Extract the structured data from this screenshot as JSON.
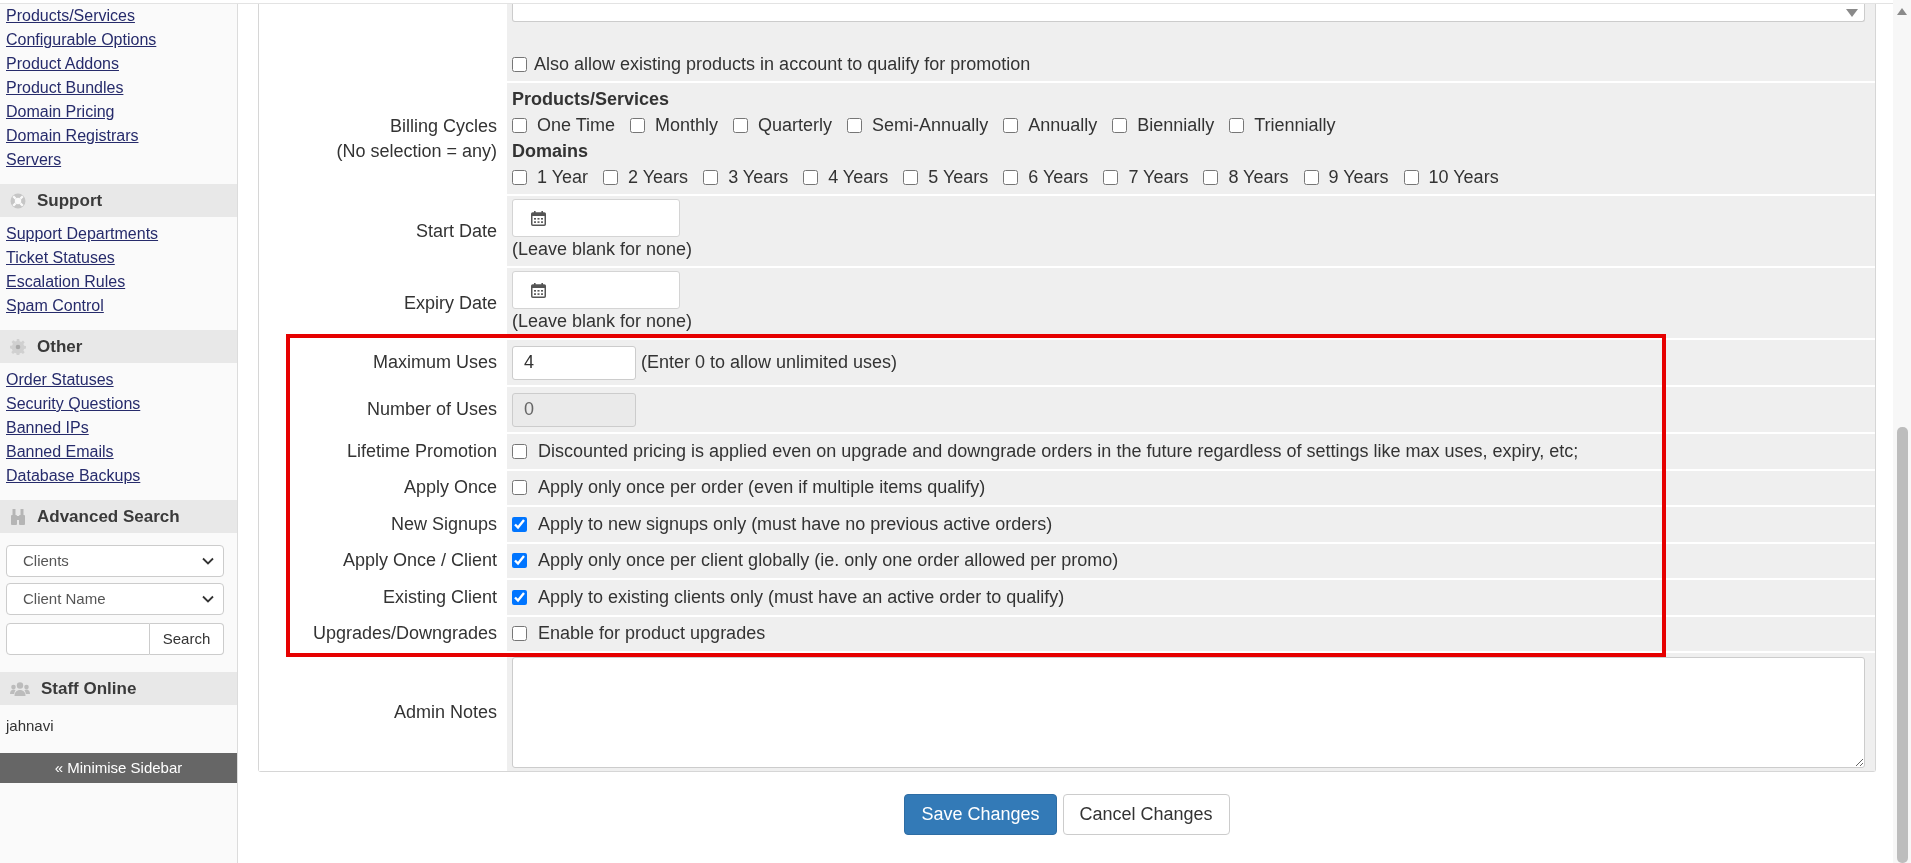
{
  "sidebar": {
    "links": [
      "Products/Services",
      "Configurable Options",
      "Product Addons",
      "Product Bundles",
      "Domain Pricing",
      "Domain Registrars",
      "Servers"
    ],
    "sections": [
      {
        "kind": "links",
        "title": "Support",
        "links": [
          "Support Departments",
          "Ticket Statuses",
          "Escalation Rules",
          "Spam Control"
        ]
      },
      {
        "kind": "links",
        "title": "Other",
        "links": [
          "Order Statuses",
          "Security Questions",
          "Banned IPs",
          "Banned Emails",
          "Database Backups"
        ]
      },
      {
        "kind": "search",
        "title": "Advanced Search",
        "filters": [
          "Clients",
          "Client Name"
        ],
        "button": "Search"
      },
      {
        "kind": "staff",
        "title": "Staff Online",
        "staff": [
          "jahnavi"
        ]
      }
    ],
    "minimise_button": "« Minimise Sidebar"
  },
  "form": {
    "sections": [
      {
        "highlighted": false,
        "rows": [
          {
            "kind": "select_checkbox",
            "checkbox": {
              "label": "Also allow existing products in account to qualify for promotion",
              "checked": false
            }
          },
          {
            "kind": "checkbox_groups",
            "label": "Billing Cycles",
            "note": "(No selection = any)",
            "groups": [
              {
                "title": "Products/Services",
                "options": [
                  {
                    "label": "One Time",
                    "checked": false
                  },
                  {
                    "label": "Monthly",
                    "checked": false
                  },
                  {
                    "label": "Quarterly",
                    "checked": false
                  },
                  {
                    "label": "Semi-Annually",
                    "checked": false
                  },
                  {
                    "label": "Annually",
                    "checked": false
                  },
                  {
                    "label": "Biennially",
                    "checked": false
                  },
                  {
                    "label": "Triennially",
                    "checked": false
                  }
                ]
              },
              {
                "title": "Domains",
                "options": [
                  {
                    "label": "1 Year",
                    "checked": false
                  },
                  {
                    "label": "2 Years",
                    "checked": false
                  },
                  {
                    "label": "3 Years",
                    "checked": false
                  },
                  {
                    "label": "4 Years",
                    "checked": false
                  },
                  {
                    "label": "5 Years",
                    "checked": false
                  },
                  {
                    "label": "6 Years",
                    "checked": false
                  },
                  {
                    "label": "7 Years",
                    "checked": false
                  },
                  {
                    "label": "8 Years",
                    "checked": false
                  },
                  {
                    "label": "9 Years",
                    "checked": false
                  },
                  {
                    "label": "10 Years",
                    "checked": false
                  }
                ]
              }
            ]
          },
          {
            "kind": "date",
            "label": "Start Date",
            "hint": "(Leave blank for none)"
          },
          {
            "kind": "date",
            "label": "Expiry Date",
            "hint": "(Leave blank for none)"
          }
        ]
      },
      {
        "highlighted": true,
        "rows": [
          {
            "kind": "text",
            "label": "Maximum Uses",
            "value": "4",
            "disabled": false,
            "hint": "(Enter 0 to allow unlimited uses)"
          },
          {
            "kind": "text",
            "label": "Number of Uses",
            "value": "0",
            "disabled": true
          },
          {
            "kind": "checkbox",
            "label": "Lifetime Promotion",
            "text": "Discounted pricing is applied even on upgrade and downgrade orders in the future regardless of settings like max uses, expiry, etc;",
            "checked": false
          },
          {
            "kind": "checkbox",
            "label": "Apply Once",
            "text": "Apply only once per order (even if multiple items qualify)",
            "checked": false
          },
          {
            "kind": "checkbox",
            "label": "New Signups",
            "text": "Apply to new signups only (must have no previous active orders)",
            "checked": true
          },
          {
            "kind": "checkbox",
            "label": "Apply Once / Client",
            "text": "Apply only once per client globally (ie. only one order allowed per promo)",
            "checked": true
          },
          {
            "kind": "checkbox",
            "label": "Existing Client",
            "text": "Apply to existing clients only (must have an active order to qualify)",
            "checked": true
          },
          {
            "kind": "checkbox",
            "label": "Upgrades/Downgrades",
            "text": "Enable for product upgrades",
            "checked": false
          }
        ]
      },
      {
        "highlighted": false,
        "rows": [
          {
            "kind": "textarea",
            "label": "Admin Notes"
          }
        ]
      }
    ]
  },
  "buttons": [
    {
      "label": "Save Changes",
      "primary": true
    },
    {
      "label": "Cancel Changes",
      "primary": false
    }
  ]
}
